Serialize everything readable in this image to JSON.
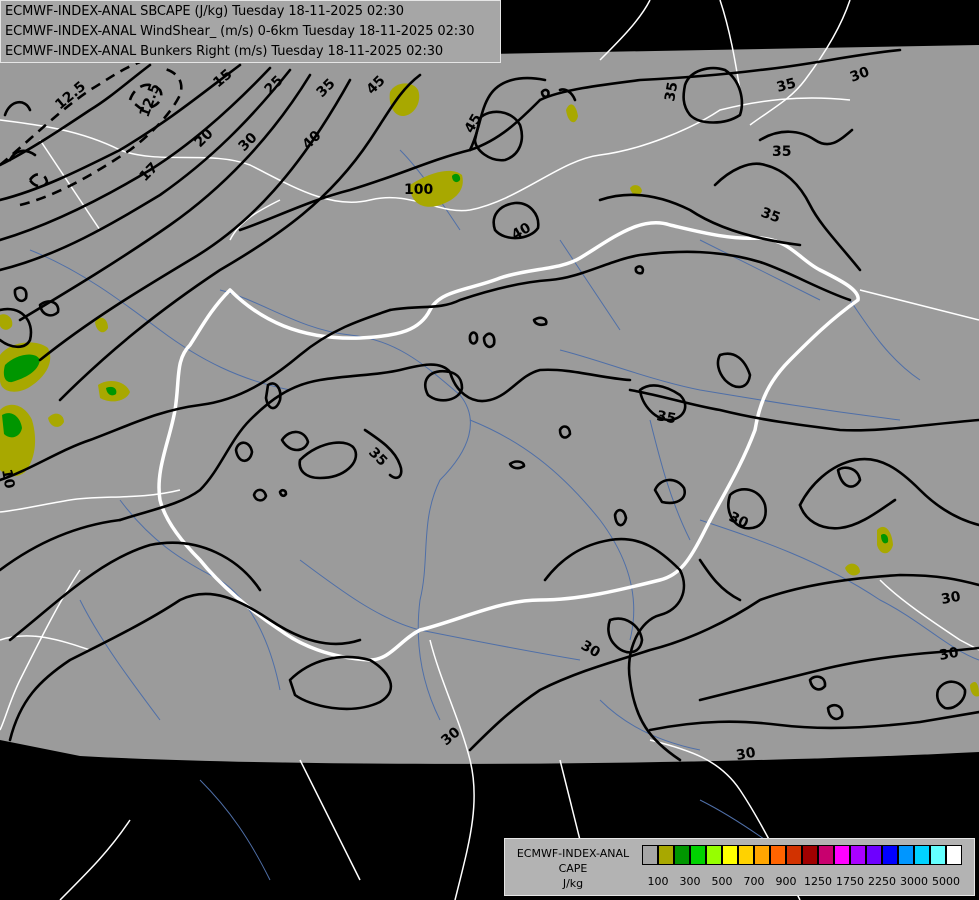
{
  "header": {
    "line1": "ECMWF-INDEX-ANAL SBCAPE (J/kg) Tuesday 18-11-2025 02:30",
    "line2": "ECMWF-INDEX-ANAL WindShear_ (m/s) 0-6km Tuesday 18-11-2025 02:30",
    "line3": "ECMWF-INDEX-ANAL Bunkers Right (m/s) Tuesday 18-11-2025 02:30"
  },
  "legend": {
    "title1": "ECMWF-INDEX-ANAL",
    "title2": "CAPE",
    "title3": "J/kg",
    "swatch_colors": [
      "#a6a6a6",
      "#a8a800",
      "#009600",
      "#00d200",
      "#96ff00",
      "#ffff00",
      "#ffd200",
      "#ffa500",
      "#ff6400",
      "#d23200",
      "#a00000",
      "#c8006e",
      "#ff00ff",
      "#aa00ff",
      "#6e00ff",
      "#0000ff",
      "#0096ff",
      "#00d2ff",
      "#64ffff",
      "#ffffff"
    ],
    "ticks": [
      "100",
      "300",
      "500",
      "700",
      "900",
      "1250",
      "1750",
      "2250",
      "3000",
      "5000"
    ]
  },
  "map": {
    "background_color": "#9b9b9b",
    "outside_color": "#000000",
    "contour_color": "#000000",
    "border_color": "#ffffff",
    "river_color": "#4f6fa8",
    "contour_labels": [
      "12.5",
      "12.5",
      "15",
      "17",
      "20",
      "25",
      "30",
      "35",
      "40",
      "45",
      "45",
      "40",
      "35",
      "35",
      "35",
      "35",
      "35",
      "30",
      "30",
      "30",
      "30",
      "30",
      "30",
      "35",
      "100",
      "10",
      "30"
    ]
  }
}
